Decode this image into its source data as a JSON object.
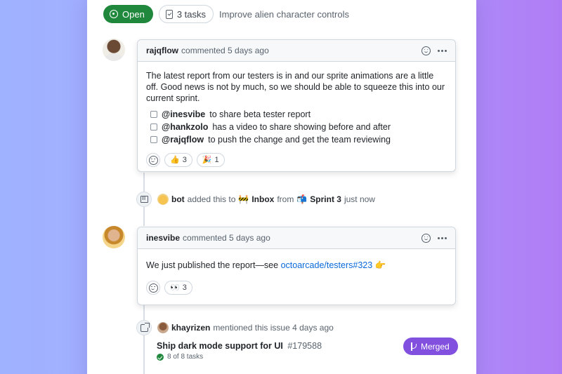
{
  "header": {
    "status": "Open",
    "tasks": "3 tasks",
    "title": "Improve alien character controls"
  },
  "comment1": {
    "author": "rajqflow",
    "meta": "commented 5 days ago",
    "body": "The latest report from our testers is in and our sprite animations are a little off. Good news is not by much, so we should be able to squeeze this into our current sprint.",
    "tasks": [
      {
        "mention": "@inesvibe",
        "text": "to share beta tester report"
      },
      {
        "mention": "@hankzolo",
        "text": "has a video to share showing before and after"
      },
      {
        "mention": "@rajqflow",
        "text": "to push the change and get the team reviewing"
      }
    ],
    "reactions": [
      {
        "emoji": "👍",
        "count": "3"
      },
      {
        "emoji": "🎉",
        "count": "1"
      }
    ]
  },
  "event1": {
    "actor": "bot",
    "action": "added this to",
    "target_emoji": "🚧",
    "target": "Inbox",
    "from": "from",
    "source_emoji": "📬",
    "source": "Sprint 3",
    "time": "just now"
  },
  "comment2": {
    "author": "inesvibe",
    "meta": "commented 5 days ago",
    "body_prefix": "We just published the report—see",
    "link": "octoarcade/testers#323",
    "suffix_emoji": "👉",
    "reactions": [
      {
        "emoji": "👀",
        "count": "3"
      }
    ]
  },
  "event2": {
    "actor": "khayrizen",
    "action": "mentioned this issue 4 days ago",
    "ref_title": "Ship dark mode support for UI",
    "ref_number": "#179588",
    "ref_tasks": "8 of 8 tasks",
    "ref_status": "Merged"
  },
  "colors": {
    "open_green": "#1f883d",
    "merged_purple": "#8250df",
    "link_blue": "#0969da"
  }
}
